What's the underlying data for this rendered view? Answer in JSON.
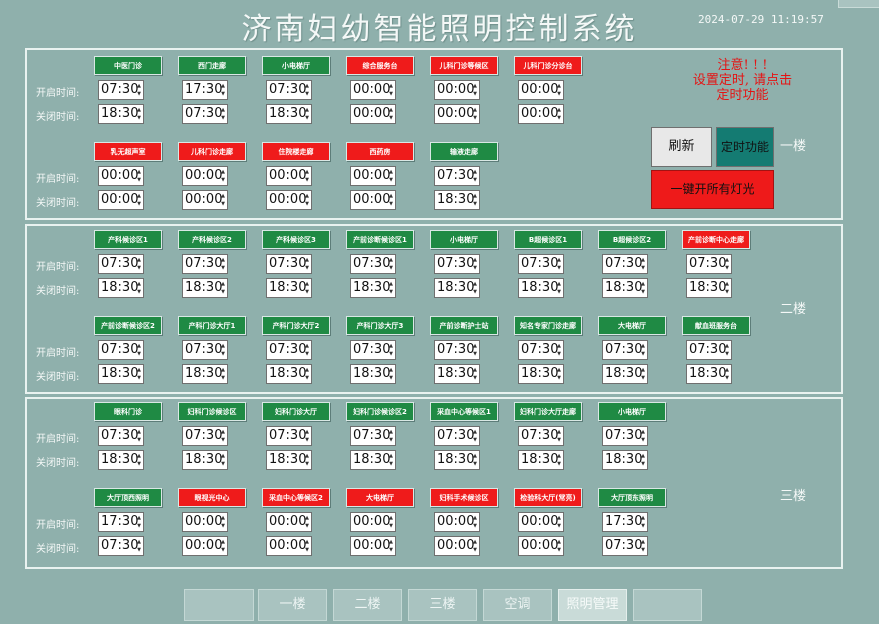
{
  "header": {
    "title": "济南妇幼智能照明控制系统",
    "datetime": "2024-07-29 11:19:57"
  },
  "labels": {
    "open": "开启时间:",
    "close": "关闭时间:"
  },
  "notice": {
    "line1": "注意! ! !",
    "line2": "设置定时, 请点击",
    "line3": "定时功能"
  },
  "buttons": {
    "refresh": "刷新",
    "timer": "定时功能",
    "all_on": "一键开所有灯光"
  },
  "floors": [
    {
      "label": "一楼",
      "rows": [
        [
          {
            "name": "中医门诊",
            "status": "green",
            "open": "07:30",
            "close": "18:30"
          },
          {
            "name": "西门走廊",
            "status": "green",
            "open": "17:30",
            "close": "07:30"
          },
          {
            "name": "小电梯厅",
            "status": "green",
            "open": "07:30",
            "close": "18:30"
          },
          {
            "name": "综合服务台",
            "status": "red",
            "open": "00:00",
            "close": "00:00"
          },
          {
            "name": "儿科门诊等候区",
            "status": "red",
            "open": "00:00",
            "close": "00:00"
          },
          {
            "name": "儿科门诊分诊台",
            "status": "red",
            "open": "00:00",
            "close": "00:00"
          }
        ],
        [
          {
            "name": "乳无超声室",
            "status": "red",
            "open": "00:00",
            "close": "00:00"
          },
          {
            "name": "儿科门诊走廊",
            "status": "red",
            "open": "00:00",
            "close": "00:00"
          },
          {
            "name": "住院楼走廊",
            "status": "red",
            "open": "00:00",
            "close": "00:00"
          },
          {
            "name": "西药房",
            "status": "red",
            "open": "00:00",
            "close": "00:00"
          },
          {
            "name": "输液走廊",
            "status": "green",
            "open": "07:30",
            "close": "18:30"
          }
        ]
      ]
    },
    {
      "label": "二楼",
      "rows": [
        [
          {
            "name": "产科候诊区1",
            "status": "green",
            "open": "07:30",
            "close": "18:30"
          },
          {
            "name": "产科候诊区2",
            "status": "green",
            "open": "07:30",
            "close": "18:30"
          },
          {
            "name": "产科候诊区3",
            "status": "green",
            "open": "07:30",
            "close": "18:30"
          },
          {
            "name": "产前诊断候诊区1",
            "status": "green",
            "open": "07:30",
            "close": "18:30"
          },
          {
            "name": "小电梯厅",
            "status": "green",
            "open": "07:30",
            "close": "18:30"
          },
          {
            "name": "B超候诊区1",
            "status": "green",
            "open": "07:30",
            "close": "18:30"
          },
          {
            "name": "B超候诊区2",
            "status": "green",
            "open": "07:30",
            "close": "18:30"
          },
          {
            "name": "产前诊断中心走廊",
            "status": "red",
            "open": "07:30",
            "close": "18:30"
          }
        ],
        [
          {
            "name": "产前诊断候诊区2",
            "status": "green",
            "open": "07:30",
            "close": "18:30"
          },
          {
            "name": "产科门诊大厅1",
            "status": "green",
            "open": "07:30",
            "close": "18:30"
          },
          {
            "name": "产科门诊大厅2",
            "status": "green",
            "open": "07:30",
            "close": "18:30"
          },
          {
            "name": "产科门诊大厅3",
            "status": "green",
            "open": "07:30",
            "close": "18:30"
          },
          {
            "name": "产前诊断护士站",
            "status": "green",
            "open": "07:30",
            "close": "18:30"
          },
          {
            "name": "知名专家门诊走廊",
            "status": "green",
            "open": "07:30",
            "close": "18:30"
          },
          {
            "name": "大电梯厅",
            "status": "green",
            "open": "07:30",
            "close": "18:30"
          },
          {
            "name": "献血班服务台",
            "status": "green",
            "open": "07:30",
            "close": "18:30"
          }
        ]
      ]
    },
    {
      "label": "三楼",
      "rows": [
        [
          {
            "name": "眼科门诊",
            "status": "green",
            "open": "07:30",
            "close": "18:30"
          },
          {
            "name": "妇科门诊候诊区",
            "status": "green",
            "open": "07:30",
            "close": "18:30"
          },
          {
            "name": "妇科门诊大厅",
            "status": "green",
            "open": "07:30",
            "close": "18:30"
          },
          {
            "name": "妇科门诊候诊区2",
            "status": "green",
            "open": "07:30",
            "close": "18:30"
          },
          {
            "name": "采血中心等候区1",
            "status": "green",
            "open": "07:30",
            "close": "18:30"
          },
          {
            "name": "妇科门诊大厅走廊",
            "status": "green",
            "open": "07:30",
            "close": "18:30"
          },
          {
            "name": "小电梯厅",
            "status": "green",
            "open": "07:30",
            "close": "18:30"
          }
        ],
        [
          {
            "name": "大厅顶西照明",
            "status": "green",
            "open": "17:30",
            "close": "07:30"
          },
          {
            "name": "眼视光中心",
            "status": "red",
            "open": "00:00",
            "close": "00:00"
          },
          {
            "name": "采血中心等候区2",
            "status": "red",
            "open": "00:00",
            "close": "00:00"
          },
          {
            "name": "大电梯厅",
            "status": "red",
            "open": "00:00",
            "close": "00:00"
          },
          {
            "name": "妇科手术候诊区",
            "status": "red",
            "open": "00:00",
            "close": "00:00"
          },
          {
            "name": "检验科大厅(常亮)",
            "status": "red",
            "open": "00:00",
            "close": "00:00"
          },
          {
            "name": "大厅顶东照明",
            "status": "green",
            "open": "17:30",
            "close": "07:30"
          }
        ]
      ]
    }
  ],
  "nav": [
    "",
    "一楼",
    "二楼",
    "三楼",
    "空调",
    "照明管理",
    ""
  ],
  "nav_active_index": 5,
  "colors": {
    "background": "#8fb0ac",
    "on": "#1f8a44",
    "off": "#ef1b1b",
    "timer_button": "#147b72"
  }
}
